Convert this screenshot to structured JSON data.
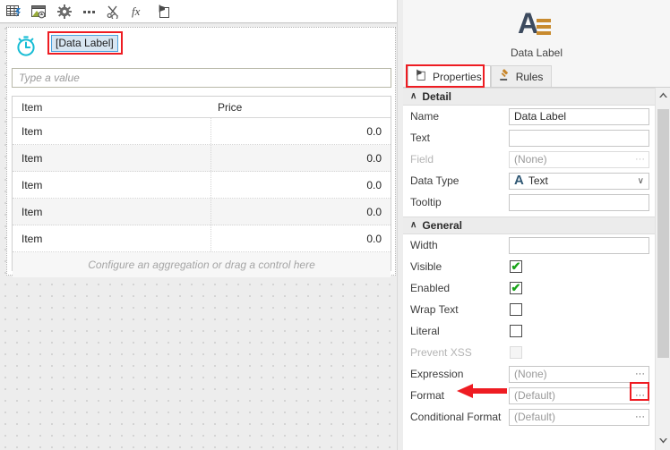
{
  "toolbar": {
    "buttons": [
      {
        "name": "grid-settings-icon",
        "tip": "Grid Settings"
      },
      {
        "name": "image-grid-icon",
        "tip": "Image Grid"
      },
      {
        "name": "gear-icon",
        "tip": "Settings"
      },
      {
        "name": "more-options-icon",
        "tip": "More"
      },
      {
        "name": "scissors-refresh-icon",
        "tip": "Cut/Refresh"
      },
      {
        "name": "fx-function-icon",
        "tip": "Function"
      },
      {
        "name": "clipboard-pin-icon",
        "tip": "Properties"
      }
    ]
  },
  "designer": {
    "data_label": "[Data Label]",
    "value_placeholder": "Type a value",
    "grid": {
      "headers": [
        "Item",
        "Price"
      ],
      "rows": [
        {
          "item": "Item",
          "price": "0.0"
        },
        {
          "item": "Item",
          "price": "0.0"
        },
        {
          "item": "Item",
          "price": "0.0"
        },
        {
          "item": "Item",
          "price": "0.0"
        },
        {
          "item": "Item",
          "price": "0.0"
        }
      ],
      "footer": "Configure an aggregation or drag a control here"
    }
  },
  "panel": {
    "title": "Data Label",
    "icon": "letter-a-lines-icon",
    "tabs": [
      {
        "label": "Properties",
        "icon": "clipboard-pin-icon",
        "active": true
      },
      {
        "label": "Rules",
        "icon": "gavel-icon",
        "active": false
      }
    ],
    "sections": [
      {
        "title": "Detail",
        "collapse_glyph": "∧",
        "rows": [
          {
            "label": "Name",
            "type": "text",
            "value": "Data Label",
            "muted": false
          },
          {
            "label": "Text",
            "type": "text",
            "value": "",
            "muted": false
          },
          {
            "label": "Field",
            "type": "text-ellipsis",
            "value": "(None)",
            "muted": true,
            "disabled": true
          },
          {
            "label": "Data Type",
            "type": "dropdown",
            "value": "Text",
            "prefix": "A",
            "arrow": "∨"
          },
          {
            "label": "Tooltip",
            "type": "text",
            "value": "",
            "muted": false
          }
        ]
      },
      {
        "title": "General",
        "collapse_glyph": "∧",
        "rows": [
          {
            "label": "Width",
            "type": "text",
            "value": "",
            "muted": false
          },
          {
            "label": "Visible",
            "type": "checkbox",
            "checked": true,
            "disabled": false
          },
          {
            "label": "Enabled",
            "type": "checkbox",
            "checked": true,
            "disabled": false
          },
          {
            "label": "Wrap Text",
            "type": "checkbox",
            "checked": false,
            "disabled": false
          },
          {
            "label": "Literal",
            "type": "checkbox",
            "checked": false,
            "disabled": false
          },
          {
            "label": "Prevent XSS",
            "type": "checkbox",
            "checked": false,
            "disabled": true
          },
          {
            "label": "Expression",
            "type": "text-ellipsis",
            "value": "(None)",
            "muted": true,
            "highlighted": true
          },
          {
            "label": "Format",
            "type": "text-ellipsis",
            "value": "(Default)",
            "muted": true
          },
          {
            "label": "Conditional Format",
            "type": "text-ellipsis",
            "value": "(Default)",
            "muted": true
          }
        ]
      }
    ],
    "ellipsis_glyph": "···",
    "check_glyph": "✔",
    "scroll_up_glyph": "∧",
    "scroll_down_glyph": "∨"
  },
  "annotations": {
    "highlight_color": "#ee1c22",
    "selection_border": "#4aa3df",
    "selection_fill": "#d8e6f2",
    "arrow_target": "Expression",
    "boxed_targets": [
      "[Data Label]",
      "Properties",
      "expression-ellipsis-button"
    ]
  }
}
